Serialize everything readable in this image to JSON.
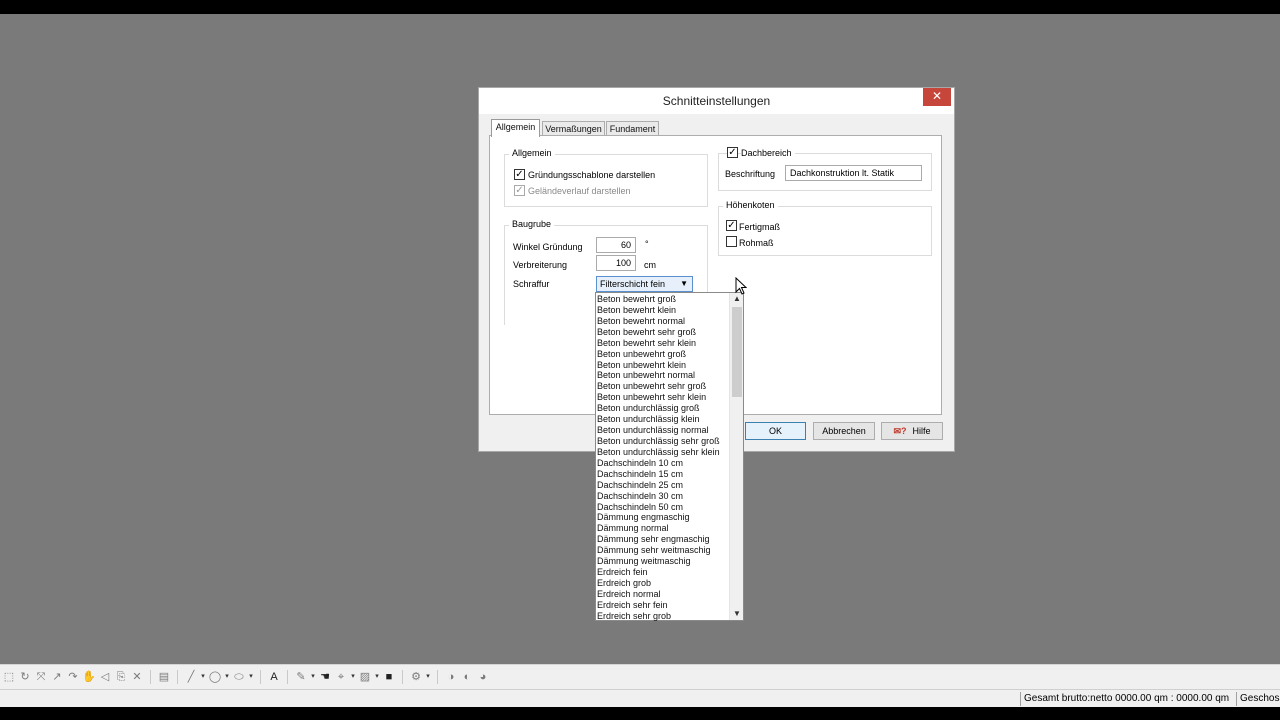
{
  "dialog": {
    "title": "Schnitteinstellungen",
    "close_label": "✕",
    "tabs": [
      {
        "label": "Allgemein",
        "active": true
      },
      {
        "label": "Vermaßungen",
        "active": false
      },
      {
        "label": "Fundament",
        "active": false
      }
    ],
    "allgemein_group": {
      "legend": "Allgemein",
      "checkboxes": [
        {
          "label": "Gründungsschablone darstellen",
          "checked": true,
          "enabled": true
        },
        {
          "label": "Geländeverlauf darstellen",
          "checked": true,
          "enabled": false
        }
      ]
    },
    "baugrube_group": {
      "legend": "Baugrube",
      "winkel_label": "Winkel Gründung",
      "winkel_value": "60",
      "winkel_unit": "°",
      "verbreiterung_label": "Verbreiterung",
      "verbreiterung_value": "100",
      "verbreiterung_unit": "cm",
      "schraffur_label": "Schraffur",
      "schraffur_value": "Filterschicht fein"
    },
    "dachbereich_group": {
      "legend": "Dachbereich",
      "checked": true,
      "beschriftung_label": "Beschriftung",
      "beschriftung_value": "Dachkonstruktion lt. Statik"
    },
    "hoehenkoten_group": {
      "legend": "Höhenkoten",
      "checkboxes": [
        {
          "label": "Fertigmaß",
          "checked": true
        },
        {
          "label": "Rohmaß",
          "checked": false
        }
      ]
    },
    "buttons": {
      "ok": "OK",
      "cancel": "Abbrechen",
      "help": "Hilfe"
    }
  },
  "dropdown": {
    "scroll_up": "▲",
    "scroll_down": "▼",
    "items": [
      "Beton bewehrt groß",
      "Beton bewehrt klein",
      "Beton bewehrt normal",
      "Beton bewehrt sehr groß",
      "Beton bewehrt sehr klein",
      "Beton unbewehrt groß",
      "Beton unbewehrt klein",
      "Beton unbewehrt normal",
      "Beton unbewehrt sehr groß",
      "Beton unbewehrt sehr klein",
      "Beton undurchlässig groß",
      "Beton undurchlässig klein",
      "Beton undurchlässig normal",
      "Beton undurchlässig sehr groß",
      "Beton undurchlässig sehr klein",
      "Dachschindeln 10 cm",
      "Dachschindeln 15 cm",
      "Dachschindeln 25 cm",
      "Dachschindeln 30 cm",
      "Dachschindeln 50 cm",
      "Dämmung engmaschig",
      "Dämmung normal",
      "Dämmung sehr engmaschig",
      "Dämmung sehr weitmaschig",
      "Dämmung weitmaschig",
      "Erdreich fein",
      "Erdreich grob",
      "Erdreich normal",
      "Erdreich sehr fein",
      "Erdreich sehr grob"
    ]
  },
  "statusbar": {
    "area_text": "Gesamt brutto:netto  0000.00 qm : 0000.00 qm",
    "geschoss_text": "Geschoss"
  },
  "toolbar": {
    "icons": [
      "select-icon",
      "rotate-icon",
      "move-icon",
      "line-icon",
      "curve-icon",
      "pan-icon",
      "mirror-icon",
      "copy-icon",
      "delete-icon",
      "layer-icon",
      "line-tool-icon",
      "circle-icon",
      "ellipse-icon",
      "text-icon",
      "pen-icon",
      "hand-icon",
      "measure-icon",
      "hatch-icon",
      "block-icon",
      "settings-icon",
      "render-icon",
      "view-icon",
      "material-icon"
    ]
  }
}
